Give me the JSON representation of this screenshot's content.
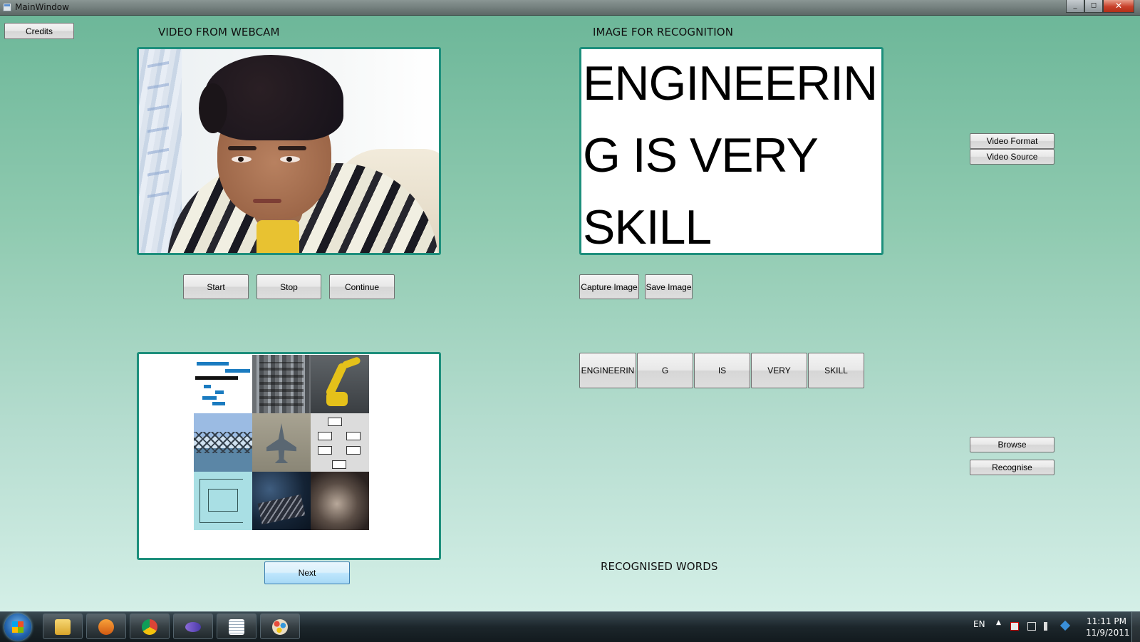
{
  "window": {
    "title": "MainWindow",
    "min": "_",
    "max": "◻",
    "close": "✕"
  },
  "buttons": {
    "credits": "Credits",
    "start": "Start",
    "stop": "Stop",
    "continue": "Continue",
    "capture": "Capture Image",
    "save": "Save Image",
    "video_format": "Video Format",
    "video_source": "Video Source",
    "browse": "Browse",
    "recognise": "Recognise",
    "next": "Next"
  },
  "labels": {
    "webcam": "VIDEO FROM WEBCAM",
    "recognition": "IMAGE FOR RECOGNITION",
    "recognised_words": "RECOGNISED WORDS"
  },
  "recognition_text": [
    "ENGINEERIN",
    "G IS VERY",
    "SKILL"
  ],
  "words": [
    "ENGINEERIN",
    "G",
    "IS",
    "VERY",
    "SKILL"
  ],
  "taskbar": {
    "apps": [
      "file-explorer",
      "media-player",
      "chrome",
      "visual-studio",
      "notepad",
      "paint"
    ],
    "language": "EN",
    "time": "11:11 PM",
    "date": "11/9/2011"
  },
  "colors": {
    "panel_border": "#1d8f7c",
    "background_top": "#6db799",
    "background_bottom": "#d4efe7"
  }
}
